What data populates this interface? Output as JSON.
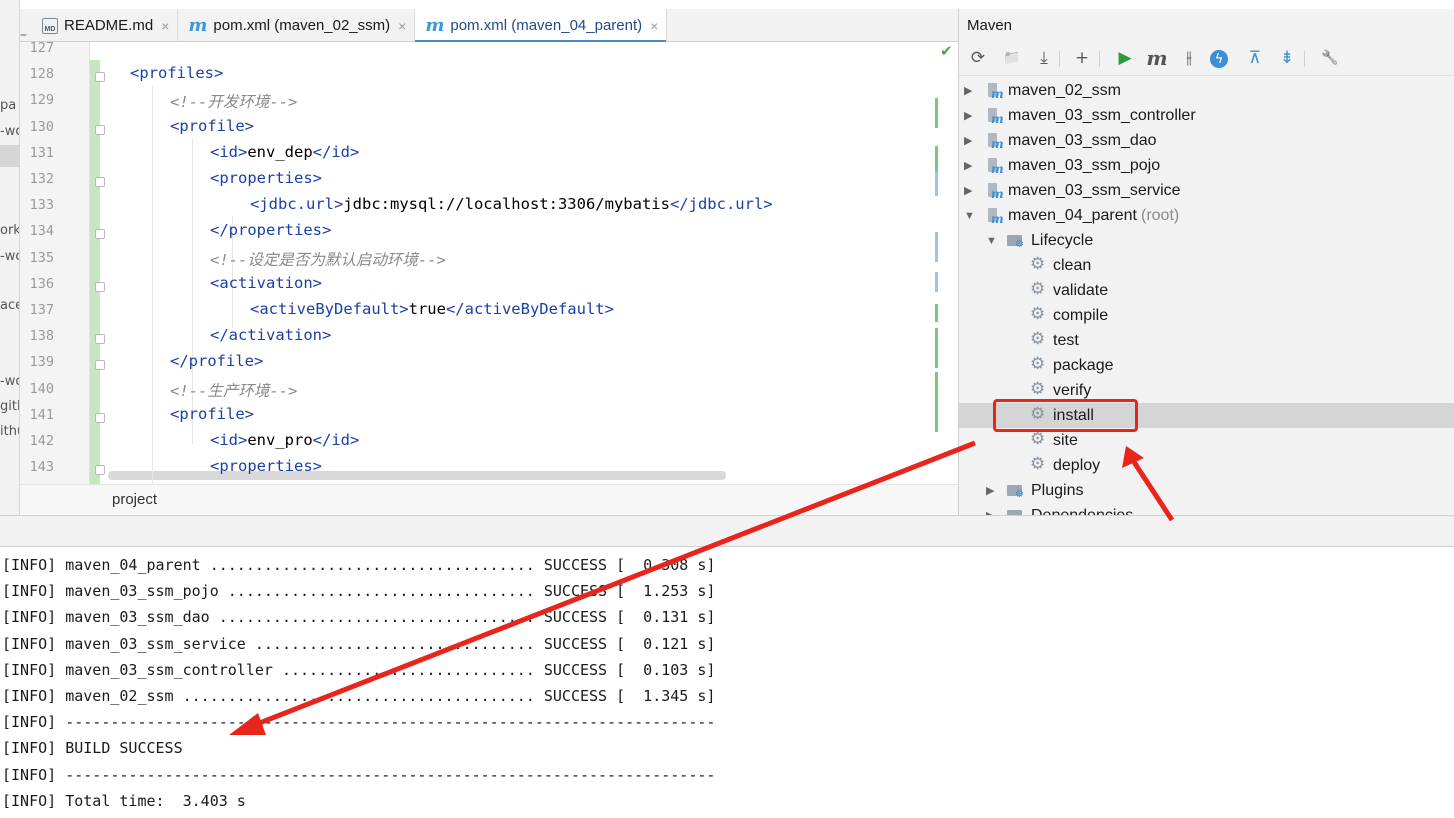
{
  "left_fragments": [
    "pa",
    "-wo",
    "orks",
    "-wo",
    "ace",
    "-wo",
    "gith",
    "ithu"
  ],
  "tabs": [
    {
      "label": "README.md",
      "icon": "markdown-file-icon",
      "icon_text": "MD"
    },
    {
      "label": "pom.xml (maven_02_ssm)",
      "icon": "maven-file-icon",
      "icon_text": "m"
    },
    {
      "label": "pom.xml (maven_04_parent)",
      "icon": "maven-file-icon",
      "icon_text": "m",
      "active": true
    }
  ],
  "tab_close_glyph": "×",
  "editor": {
    "lines": [
      {
        "num": "127",
        "indent": 0,
        "parts": []
      },
      {
        "num": "128",
        "indent": 1,
        "parts": [
          {
            "t": "tag",
            "v": "<profiles>"
          }
        ]
      },
      {
        "num": "129",
        "indent": 2,
        "parts": [
          {
            "t": "cmt",
            "v": "<!--开发环境-->"
          }
        ]
      },
      {
        "num": "130",
        "indent": 2,
        "parts": [
          {
            "t": "tag",
            "v": "<profile>"
          }
        ]
      },
      {
        "num": "131",
        "indent": 3,
        "parts": [
          {
            "t": "tag",
            "v": "<id>"
          },
          {
            "t": "txt",
            "v": "env_dep"
          },
          {
            "t": "tag",
            "v": "</id>"
          }
        ]
      },
      {
        "num": "132",
        "indent": 3,
        "parts": [
          {
            "t": "tag",
            "v": "<properties>"
          }
        ]
      },
      {
        "num": "133",
        "indent": 4,
        "parts": [
          {
            "t": "tag",
            "v": "<jdbc.url>"
          },
          {
            "t": "txt",
            "v": "jdbc:mysql://localhost:3306/mybatis"
          },
          {
            "t": "tag",
            "v": "</jdbc.url>"
          }
        ]
      },
      {
        "num": "134",
        "indent": 3,
        "parts": [
          {
            "t": "tag",
            "v": "</properties>"
          }
        ]
      },
      {
        "num": "135",
        "indent": 3,
        "parts": [
          {
            "t": "cmt",
            "v": "<!--设定是否为默认启动环境-->"
          }
        ]
      },
      {
        "num": "136",
        "indent": 3,
        "parts": [
          {
            "t": "tag",
            "v": "<activation>"
          }
        ]
      },
      {
        "num": "137",
        "indent": 4,
        "parts": [
          {
            "t": "tag",
            "v": "<activeByDefault>"
          },
          {
            "t": "txt",
            "v": "true"
          },
          {
            "t": "tag",
            "v": "</activeByDefault>"
          }
        ]
      },
      {
        "num": "138",
        "indent": 3,
        "parts": [
          {
            "t": "tag",
            "v": "</activation>"
          }
        ]
      },
      {
        "num": "139",
        "indent": 2,
        "parts": [
          {
            "t": "tag",
            "v": "</profile>"
          }
        ]
      },
      {
        "num": "140",
        "indent": 2,
        "parts": [
          {
            "t": "cmt",
            "v": "<!--生产环境-->"
          }
        ]
      },
      {
        "num": "141",
        "indent": 2,
        "parts": [
          {
            "t": "tag",
            "v": "<profile>"
          }
        ]
      },
      {
        "num": "142",
        "indent": 3,
        "parts": [
          {
            "t": "tag",
            "v": "<id>"
          },
          {
            "t": "txt",
            "v": "env_pro"
          },
          {
            "t": "tag",
            "v": "</id>"
          }
        ]
      },
      {
        "num": "143",
        "indent": 3,
        "parts": [
          {
            "t": "tag",
            "v": "<properties>"
          }
        ]
      }
    ],
    "fold_markers": [
      "128",
      "130",
      "132",
      "134",
      "136",
      "138",
      "139",
      "141",
      "143"
    ],
    "status_glyph": "✔"
  },
  "breadcrumb": "project",
  "maven": {
    "title": "Maven",
    "toolbar": [
      {
        "name": "reload-icon",
        "glyph": "⟳"
      },
      {
        "name": "add-maven-project-icon",
        "glyph": "📁"
      },
      {
        "name": "download-icon",
        "glyph": "⤓"
      },
      {
        "name": "plus-icon",
        "glyph": "+"
      },
      {
        "name": "run-icon",
        "glyph": "▶"
      },
      {
        "name": "execute-goal-icon",
        "glyph": "m"
      },
      {
        "name": "toggle-offline-icon",
        "glyph": "⫲"
      },
      {
        "name": "skip-tests-icon",
        "glyph": "ϟ"
      },
      {
        "name": "show-dependencies-icon",
        "glyph": "⊼"
      },
      {
        "name": "collapse-all-icon",
        "glyph": "⇟"
      },
      {
        "name": "settings-wrench-icon",
        "glyph": "🔧"
      }
    ],
    "tree": [
      {
        "type": "module",
        "label": "maven_02_ssm",
        "expanded": false
      },
      {
        "type": "module",
        "label": "maven_03_ssm_controller",
        "expanded": false
      },
      {
        "type": "module",
        "label": "maven_03_ssm_dao",
        "expanded": false
      },
      {
        "type": "module",
        "label": "maven_03_ssm_pojo",
        "expanded": false
      },
      {
        "type": "module",
        "label": "maven_03_ssm_service",
        "expanded": false
      },
      {
        "type": "module",
        "label": "maven_04_parent",
        "suffix": "(root)",
        "expanded": true
      },
      {
        "type": "folder",
        "label": "Lifecycle",
        "expanded": true
      },
      {
        "type": "goal",
        "label": "clean"
      },
      {
        "type": "goal",
        "label": "validate"
      },
      {
        "type": "goal",
        "label": "compile"
      },
      {
        "type": "goal",
        "label": "test"
      },
      {
        "type": "goal",
        "label": "package"
      },
      {
        "type": "goal",
        "label": "verify"
      },
      {
        "type": "goal",
        "label": "install",
        "selected": true
      },
      {
        "type": "goal",
        "label": "site"
      },
      {
        "type": "goal",
        "label": "deploy"
      },
      {
        "type": "folder",
        "label": "Plugins",
        "expanded": false
      },
      {
        "type": "folder",
        "label": "Dependencies",
        "expanded": false
      }
    ]
  },
  "console": {
    "lines": [
      "[INFO] maven_04_parent .................................... SUCCESS [  0.308 s]",
      "[INFO] maven_03_ssm_pojo .................................. SUCCESS [  1.253 s]",
      "[INFO] maven_03_ssm_dao ................................... SUCCESS [  0.131 s]",
      "[INFO] maven_03_ssm_service ............................... SUCCESS [  0.121 s]",
      "[INFO] maven_03_ssm_controller ............................ SUCCESS [  0.103 s]",
      "[INFO] maven_02_ssm ....................................... SUCCESS [  1.345 s]",
      "[INFO] ------------------------------------------------------------------------",
      "[INFO] BUILD SUCCESS",
      "[INFO] ------------------------------------------------------------------------",
      "[INFO] Total time:  3.403 s"
    ]
  },
  "annotation_color": "#e8251c"
}
